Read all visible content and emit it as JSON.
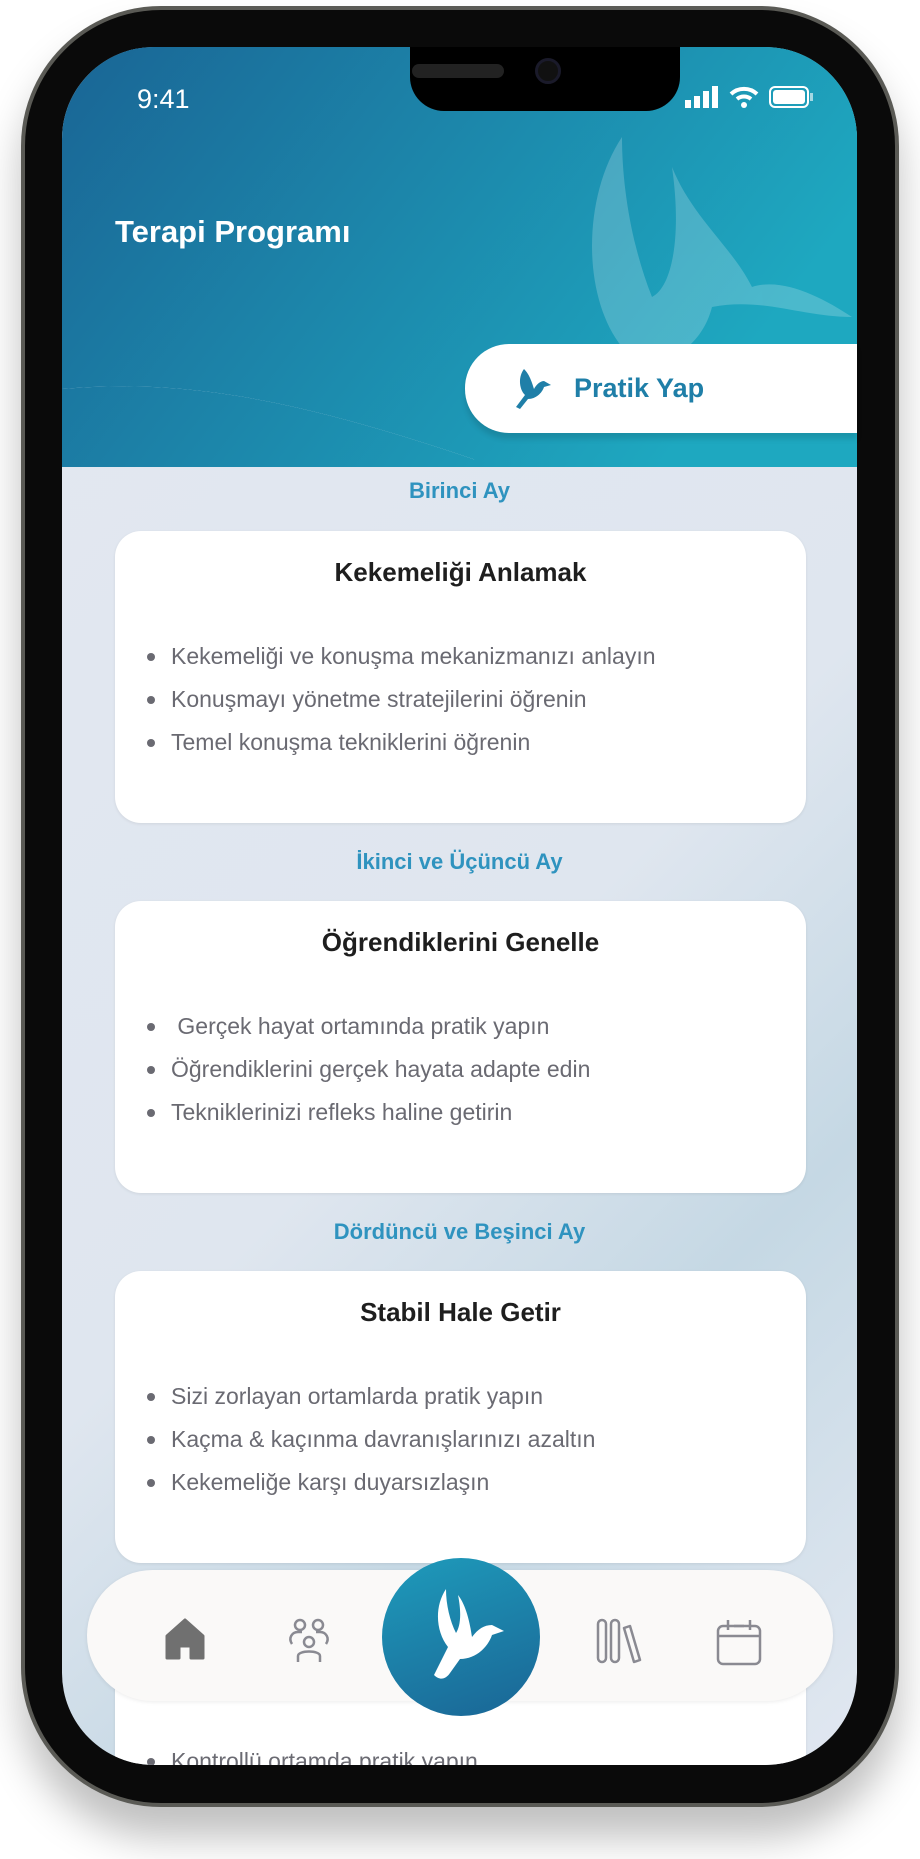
{
  "status_bar": {
    "time": "9:41"
  },
  "header": {
    "title": "Terapi Programı",
    "practice_button": "Pratik Yap"
  },
  "colors": {
    "accent": "#2f93bf",
    "header_start": "#1a6595",
    "header_end": "#1ea8c0",
    "card": "#ffffff"
  },
  "program": [
    {
      "month": "Birinci Ay",
      "title": "Kekemeliği Anlamak",
      "items": [
        "Kekemeliği ve konuşma mekanizmanızı anlayın",
        "Konuşmayı yönetme stratejilerini öğrenin",
        "Temel konuşma tekniklerini öğrenin"
      ]
    },
    {
      "month": "İkinci ve Üçüncü Ay",
      "title": "Öğrendiklerini Genelle",
      "items": [
        " Gerçek hayat ortamında pratik yapın",
        "Öğrendiklerini gerçek hayata adapte edin",
        "Tekniklerinizi refleks haline getirin"
      ]
    },
    {
      "month": "Dördüncü ve Beşinci Ay",
      "title": "Stabil Hale Getir",
      "items": [
        "Sizi zorlayan ortamlarda pratik yapın",
        "Kaçma & kaçınma davranışlarınızı azaltın",
        "Kekemeliğe karşı duyarsızlaşın"
      ]
    },
    {
      "items": [
        "Kontrollü ortamda pratik yapın"
      ]
    }
  ],
  "nav": {
    "items": [
      "home-icon",
      "community-icon",
      "bird-icon",
      "library-icon",
      "calendar-icon"
    ],
    "active": "home-icon"
  }
}
